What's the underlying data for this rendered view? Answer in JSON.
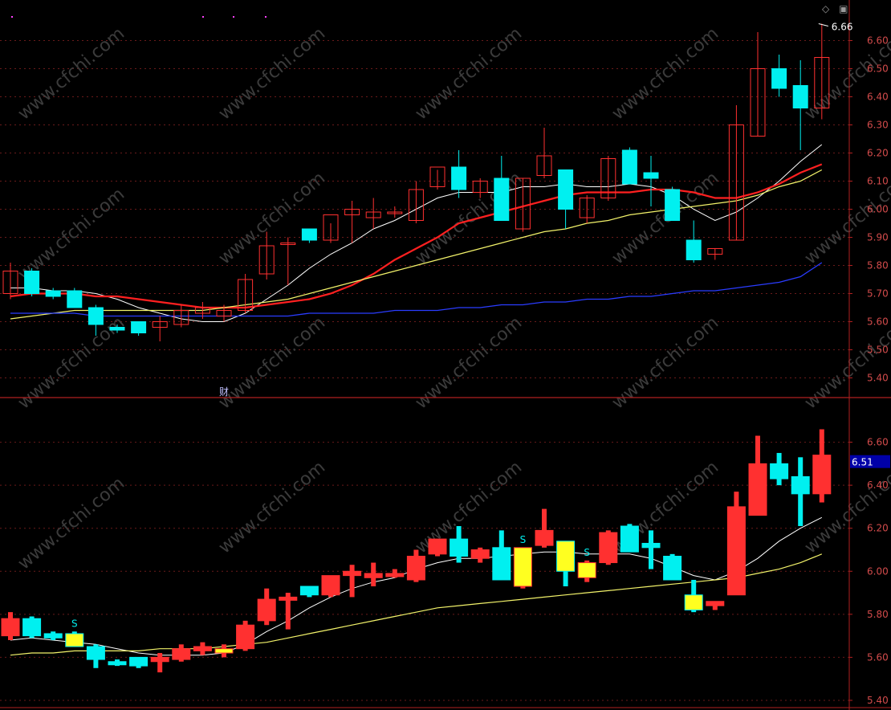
{
  "colors": {
    "up": "#ff3030",
    "down": "#00f0f0",
    "ma5": "#ffffff",
    "ma10": "#ff2020",
    "ma20": "#f2f26a",
    "ma60": "#2a3cff",
    "axis": "#b02020",
    "grid": "#6a1a1a",
    "tick": "#d24b4b",
    "signal_bar": "#ffff20"
  },
  "icons": {
    "diamond": "diamond-icon",
    "window": "window-icon"
  },
  "watermark": "www.cfchi.com",
  "chart_data": [
    {
      "type": "candlestick",
      "panel": "top",
      "ylim": [
        5.33,
        6.73
      ],
      "yticks": [
        "6.60",
        "6.50",
        "6.40",
        "6.30",
        "6.20",
        "6.10",
        "6.00",
        "5.90",
        "5.80",
        "5.70",
        "5.60",
        "5.50",
        "5.40"
      ],
      "max_label": "6.66",
      "finance_marker": "财",
      "finance_marker_index": 10,
      "ohlc": [
        [
          5.7,
          5.81,
          5.68,
          5.78
        ],
        [
          5.78,
          5.79,
          5.69,
          5.7
        ],
        [
          5.71,
          5.72,
          5.68,
          5.69
        ],
        [
          5.71,
          5.72,
          5.65,
          5.65
        ],
        [
          5.65,
          5.66,
          5.55,
          5.59
        ],
        [
          5.58,
          5.59,
          5.56,
          5.57
        ],
        [
          5.6,
          5.6,
          5.55,
          5.56
        ],
        [
          5.58,
          5.62,
          5.53,
          5.6
        ],
        [
          5.59,
          5.66,
          5.58,
          5.64
        ],
        [
          5.63,
          5.67,
          5.61,
          5.65
        ],
        [
          5.62,
          5.66,
          5.6,
          5.64
        ],
        [
          5.64,
          5.77,
          5.63,
          5.75
        ],
        [
          5.77,
          5.92,
          5.75,
          5.87
        ],
        [
          5.88,
          5.9,
          5.73,
          5.88
        ],
        [
          5.93,
          5.93,
          5.88,
          5.89
        ],
        [
          5.89,
          5.95,
          5.88,
          5.98
        ],
        [
          5.98,
          6.03,
          5.88,
          6.0
        ],
        [
          5.97,
          6.04,
          5.93,
          5.99
        ],
        [
          5.99,
          6.01,
          5.97,
          5.99
        ],
        [
          5.96,
          6.1,
          5.95,
          6.07
        ],
        [
          6.08,
          6.14,
          6.07,
          6.15
        ],
        [
          6.15,
          6.21,
          6.04,
          6.07
        ],
        [
          6.06,
          6.11,
          6.04,
          6.1
        ],
        [
          6.11,
          6.19,
          6.04,
          5.96
        ],
        [
          5.93,
          6.11,
          5.92,
          6.11
        ],
        [
          6.12,
          6.29,
          6.11,
          6.19
        ],
        [
          6.14,
          6.14,
          5.93,
          6.0
        ],
        [
          5.97,
          6.05,
          5.95,
          6.04
        ],
        [
          6.04,
          6.19,
          6.03,
          6.18
        ],
        [
          6.21,
          6.22,
          6.09,
          6.09
        ],
        [
          6.13,
          6.19,
          6.01,
          6.11
        ],
        [
          6.07,
          6.08,
          5.97,
          5.96
        ],
        [
          5.89,
          5.96,
          5.81,
          5.82
        ],
        [
          5.84,
          5.86,
          5.82,
          5.86
        ],
        [
          5.89,
          6.37,
          5.89,
          6.3
        ],
        [
          6.26,
          6.63,
          6.26,
          6.5
        ],
        [
          6.5,
          6.55,
          6.4,
          6.43
        ],
        [
          6.44,
          6.53,
          6.21,
          6.36
        ],
        [
          6.36,
          6.66,
          6.32,
          6.54
        ]
      ],
      "series": [
        {
          "key": "ma5",
          "values": [
            5.72,
            5.72,
            5.71,
            5.71,
            5.7,
            5.68,
            5.65,
            5.63,
            5.61,
            5.6,
            5.6,
            5.63,
            5.68,
            5.73,
            5.79,
            5.84,
            5.88,
            5.93,
            5.96,
            6.0,
            6.04,
            6.06,
            6.06,
            6.06,
            6.08,
            6.08,
            6.09,
            6.08,
            6.08,
            6.09,
            6.08,
            6.05,
            6.0,
            5.96,
            5.99,
            6.04,
            6.1,
            6.17,
            6.23
          ]
        },
        {
          "key": "ma10",
          "values": [
            5.69,
            5.7,
            5.7,
            5.7,
            5.69,
            5.69,
            5.68,
            5.67,
            5.66,
            5.65,
            5.65,
            5.65,
            5.66,
            5.67,
            5.68,
            5.7,
            5.73,
            5.77,
            5.82,
            5.86,
            5.9,
            5.95,
            5.97,
            5.99,
            6.01,
            6.03,
            6.05,
            6.06,
            6.06,
            6.06,
            6.07,
            6.07,
            6.06,
            6.04,
            6.04,
            6.06,
            6.09,
            6.13,
            6.16
          ]
        },
        {
          "key": "ma20",
          "values": [
            5.61,
            5.62,
            5.63,
            5.64,
            5.64,
            5.64,
            5.64,
            5.64,
            5.64,
            5.64,
            5.65,
            5.66,
            5.67,
            5.68,
            5.7,
            5.72,
            5.74,
            5.76,
            5.78,
            5.8,
            5.82,
            5.84,
            5.86,
            5.88,
            5.9,
            5.92,
            5.93,
            5.95,
            5.96,
            5.98,
            5.99,
            6.0,
            6.01,
            6.02,
            6.03,
            6.05,
            6.08,
            6.1,
            6.14
          ]
        },
        {
          "key": "ma60",
          "values": [
            5.63,
            5.63,
            5.63,
            5.63,
            5.62,
            5.62,
            5.62,
            5.62,
            5.62,
            5.62,
            5.62,
            5.62,
            5.62,
            5.62,
            5.63,
            5.63,
            5.63,
            5.63,
            5.64,
            5.64,
            5.64,
            5.65,
            5.65,
            5.66,
            5.66,
            5.67,
            5.67,
            5.68,
            5.68,
            5.69,
            5.69,
            5.7,
            5.71,
            5.71,
            5.72,
            5.73,
            5.74,
            5.76,
            5.81
          ]
        }
      ]
    },
    {
      "type": "signal-bars",
      "panel": "bottom",
      "ylim": [
        5.37,
        6.8
      ],
      "yticks": [
        "6.60",
        "6.40",
        "6.20",
        "6.00",
        "5.80",
        "5.60",
        "5.40"
      ],
      "current_value": "6.51",
      "s_marker": "S",
      "s_indices": [
        3,
        24,
        27
      ],
      "highlight_indices": [
        3,
        10,
        24,
        26,
        27,
        32
      ],
      "series": [
        {
          "key": "ma5",
          "values": [
            5.68,
            5.69,
            5.68,
            5.67,
            5.66,
            5.64,
            5.62,
            5.61,
            5.61,
            5.61,
            5.62,
            5.66,
            5.72,
            5.77,
            5.83,
            5.88,
            5.92,
            5.95,
            5.97,
            6.01,
            6.04,
            6.06,
            6.06,
            6.07,
            6.08,
            6.09,
            6.09,
            6.08,
            6.08,
            6.08,
            6.06,
            6.02,
            5.98,
            5.96,
            6.0,
            6.06,
            6.14,
            6.2,
            6.25
          ]
        },
        {
          "key": "ma20",
          "values": [
            5.61,
            5.62,
            5.62,
            5.63,
            5.63,
            5.63,
            5.63,
            5.64,
            5.64,
            5.64,
            5.65,
            5.66,
            5.67,
            5.69,
            5.71,
            5.73,
            5.75,
            5.77,
            5.79,
            5.81,
            5.83,
            5.84,
            5.85,
            5.86,
            5.87,
            5.88,
            5.89,
            5.9,
            5.91,
            5.92,
            5.93,
            5.94,
            5.95,
            5.96,
            5.97,
            5.99,
            6.01,
            6.04,
            6.08
          ]
        }
      ]
    }
  ]
}
